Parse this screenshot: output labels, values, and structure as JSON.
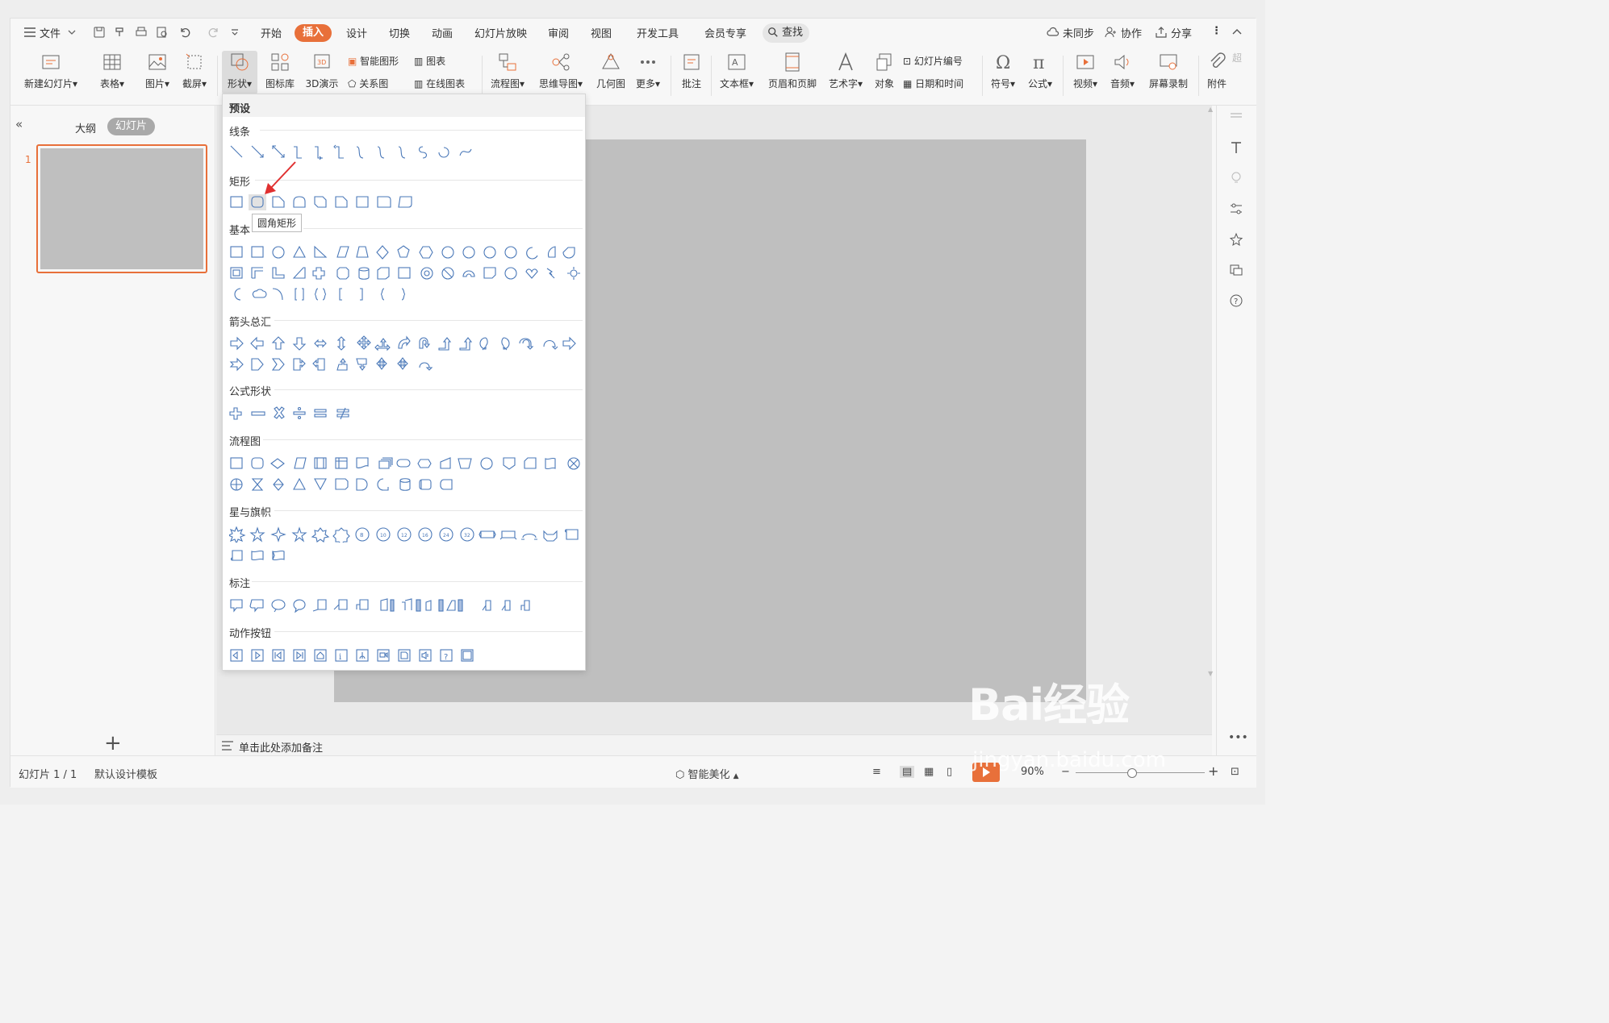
{
  "menubar": {
    "file": "文件",
    "tabs": [
      "开始",
      "插入",
      "设计",
      "切换",
      "动画",
      "幻灯片放映",
      "审阅",
      "视图",
      "开发工具",
      "会员专享"
    ],
    "active_tab": "插入",
    "search": "查找",
    "right": {
      "sync": "未同步",
      "collab": "协作",
      "share": "分享"
    }
  },
  "ribbon": {
    "new_slide": "新建幻灯片",
    "table": "表格",
    "picture": "图片",
    "screenshot": "截屏",
    "shape": "形状",
    "icon_lib": "图标库",
    "demo3d": "3D演示",
    "smart_art": "智能图形",
    "chart": "图表",
    "relation": "关系图",
    "online_chart": "在线图表",
    "flowchart": "流程图",
    "mindmap": "思维导图",
    "geometry": "几何图",
    "more": "更多",
    "comment": "批注",
    "textbox": "文本框",
    "header_footer": "页眉和页脚",
    "wordart": "艺术字",
    "object": "对象",
    "slide_number": "幻灯片编号",
    "datetime": "日期和时间",
    "symbol": "符号",
    "formula": "公式",
    "video": "视频",
    "audio": "音频",
    "screen_record": "屏幕录制",
    "attachment": "附件",
    "cut_label": "超"
  },
  "left_panel": {
    "outline": "大纲",
    "slides": "幻灯片",
    "slide_number": "1"
  },
  "notes": {
    "placeholder": "单击此处添加备注"
  },
  "status": {
    "slide_count": "幻灯片 1 / 1",
    "template": "默认设计模板",
    "beautify": "智能美化",
    "zoom": "90%"
  },
  "dropdown": {
    "header": "预设",
    "categories": [
      "线条",
      "矩形",
      "基本",
      "箭头总汇",
      "公式形状",
      "流程图",
      "星与旗帜",
      "标注",
      "动作按钮"
    ],
    "tooltip": "圆角矩形"
  },
  "watermark": {
    "brand": "Bai经验",
    "url": "jingyan.baidu.com"
  },
  "colors": {
    "accent": "#e8703a",
    "shape_stroke": "#4a78b8",
    "slide_gray": "#bfbfbf"
  }
}
